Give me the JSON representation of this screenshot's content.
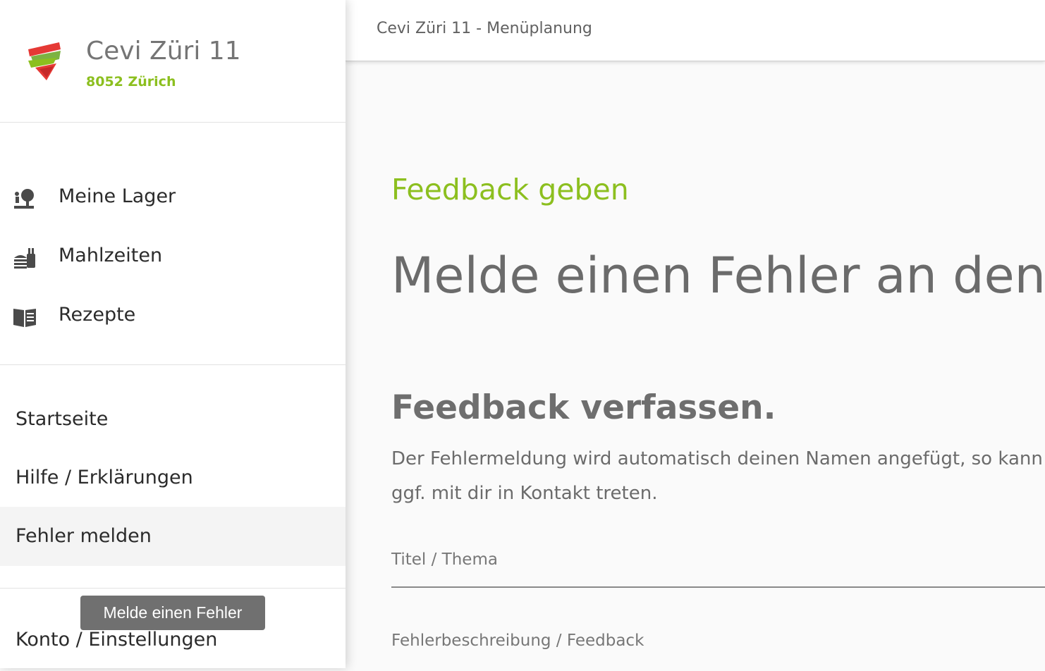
{
  "app": {
    "name": "Cevi Züri 11",
    "location": "8052 Zürich",
    "logo_icon": "cevi-logo-icon",
    "colors": {
      "accent": "#8cbf1f",
      "logo_red": "#e53935",
      "logo_green": "#7cb342"
    }
  },
  "topbar": {
    "title": "Cevi Züri 11 - Menüplanung"
  },
  "sidebar": {
    "nav_items": [
      {
        "label": "Meine Lager",
        "icon": "camp-tree-icon"
      },
      {
        "label": "Mahlzeiten",
        "icon": "meal-icon"
      },
      {
        "label": "Rezepte",
        "icon": "book-icon"
      }
    ],
    "links": [
      {
        "label": "Startseite"
      },
      {
        "label": "Hilfe / Erklärungen"
      },
      {
        "label": "Fehler melden",
        "active": true
      },
      {
        "label": "Konto / Einstellungen"
      }
    ],
    "tooltip": "Melde einen Fehler"
  },
  "main": {
    "eyebrow": "Feedback geben",
    "headline": "Melde einen Fehler an den Entwickler",
    "section_title": "Feedback verfassen.",
    "section_text_line1": "Der Fehlermeldung wird automatisch deinen Namen angefügt, so kann der Entwickler",
    "section_text_line2": "ggf. mit dir in Kontakt treten.",
    "fields": {
      "title_label": "Titel / Thema",
      "description_label": "Fehlerbeschreibung / Feedback"
    }
  }
}
